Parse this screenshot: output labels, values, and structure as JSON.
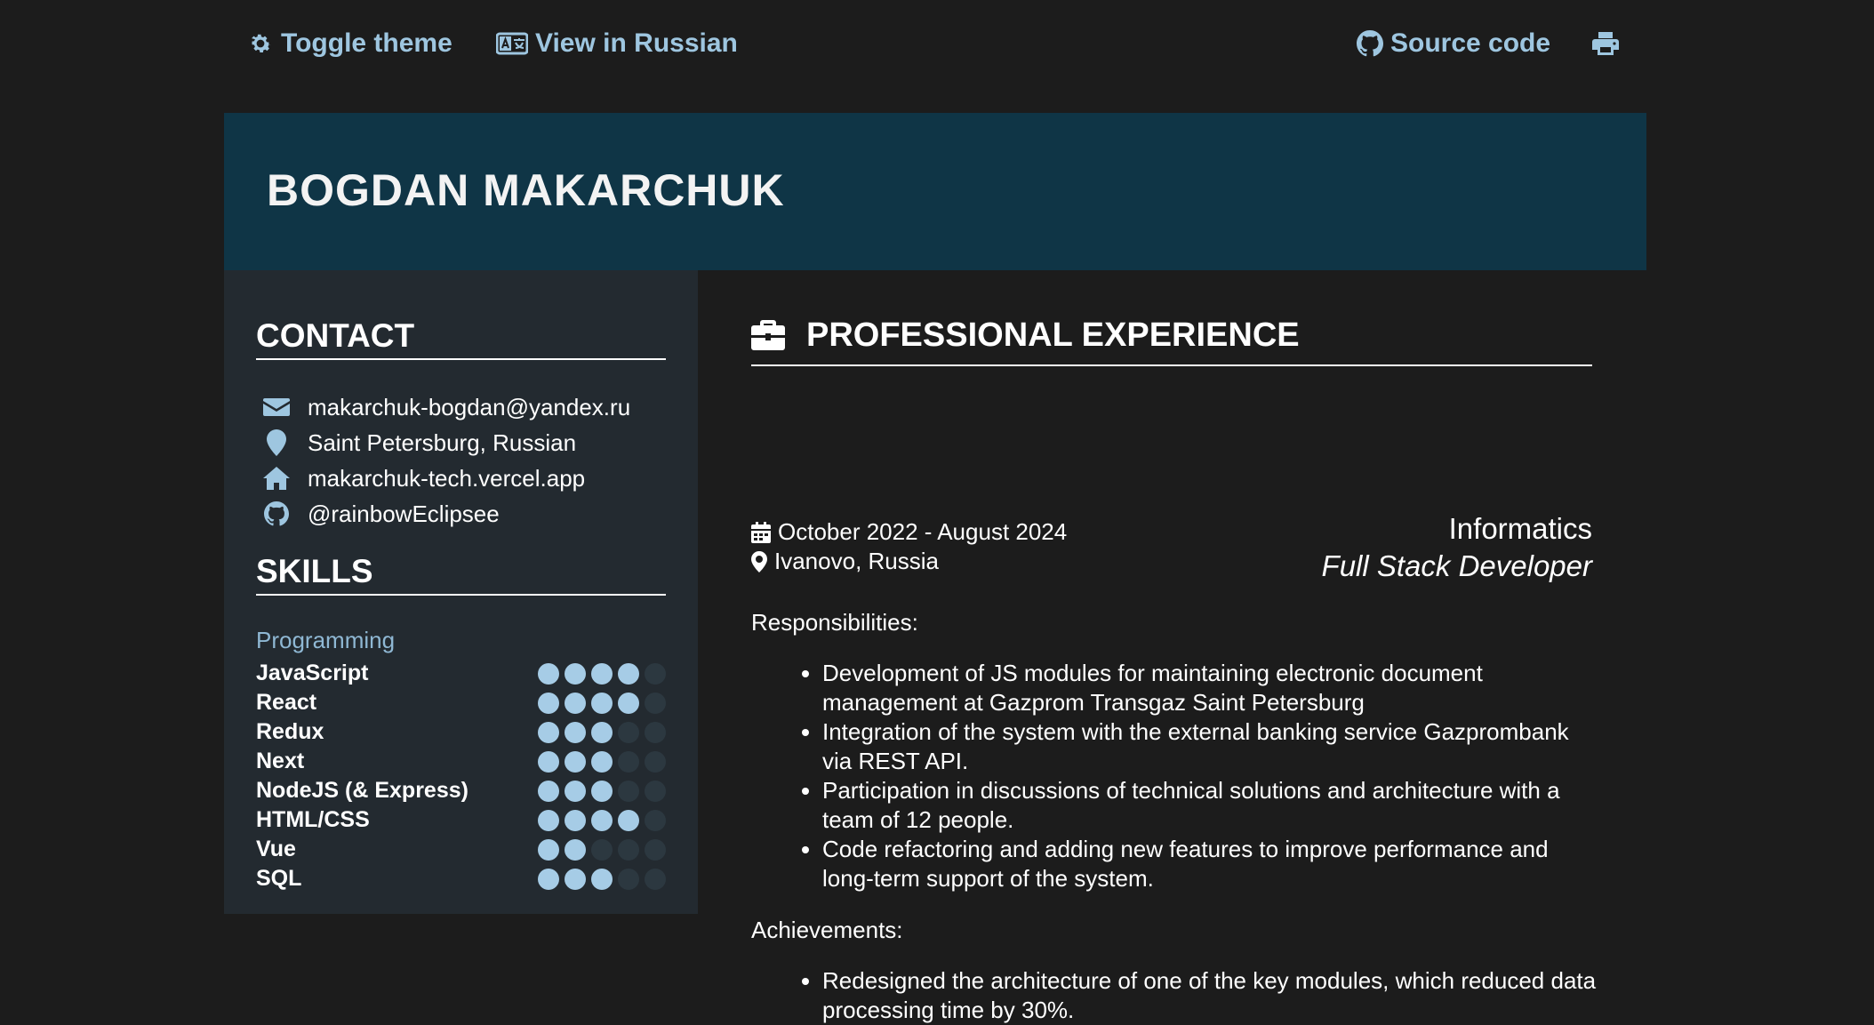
{
  "topbar": {
    "toggle_theme": "Toggle theme",
    "view_language": "View in Russian",
    "source_code": "Source code"
  },
  "header": {
    "name": "BOGDAN MAKARCHUK"
  },
  "contact": {
    "heading": "CONTACT",
    "items": [
      {
        "icon": "envelope-icon",
        "text": "makarchuk-bogdan@yandex.ru"
      },
      {
        "icon": "map-pin-icon",
        "text": "Saint Petersburg, Russian"
      },
      {
        "icon": "home-icon",
        "text": "makarchuk-tech.vercel.app"
      },
      {
        "icon": "github-icon",
        "text": "@rainbowEclipsee"
      }
    ]
  },
  "skills": {
    "heading": "SKILLS",
    "category": "Programming",
    "items": [
      {
        "name": "JavaScript",
        "level": 4,
        "max": 5
      },
      {
        "name": "React",
        "level": 4,
        "max": 5
      },
      {
        "name": "Redux",
        "level": 3,
        "max": 5
      },
      {
        "name": "Next",
        "level": 3,
        "max": 5
      },
      {
        "name": "NodeJS (& Express)",
        "level": 3,
        "max": 5
      },
      {
        "name": "HTML/CSS",
        "level": 4,
        "max": 5
      },
      {
        "name": "Vue",
        "level": 2,
        "max": 5
      },
      {
        "name": "SQL",
        "level": 3,
        "max": 5
      }
    ]
  },
  "experience": {
    "heading": "PROFESSIONAL EXPERIENCE",
    "job": {
      "dates": "October 2022 - August 2024",
      "location": "Ivanovo, Russia",
      "company": "Informatics",
      "position": "Full Stack Developer",
      "responsibilities_label": "Responsibilities:",
      "responsibilities": [
        "Development of JS modules for maintaining electronic document management at Gazprom Transgaz Saint Petersburg",
        "Integration of the system with the external banking service Gazprombank via REST API.",
        "Participation in discussions of technical solutions and architecture with a team of 12 people.",
        "Code refactoring and adding new features to improve performance and long-term support of the system."
      ],
      "achievements_label": "Achievements:",
      "achievements": [
        "Redesigned the architecture of one of the key modules, which reduced data processing time by 30%."
      ]
    }
  },
  "colors": {
    "background": "#1c1c1c",
    "header_bg": "#0f3546",
    "sidebar_bg": "#232a30",
    "accent": "#9ec6e0"
  }
}
